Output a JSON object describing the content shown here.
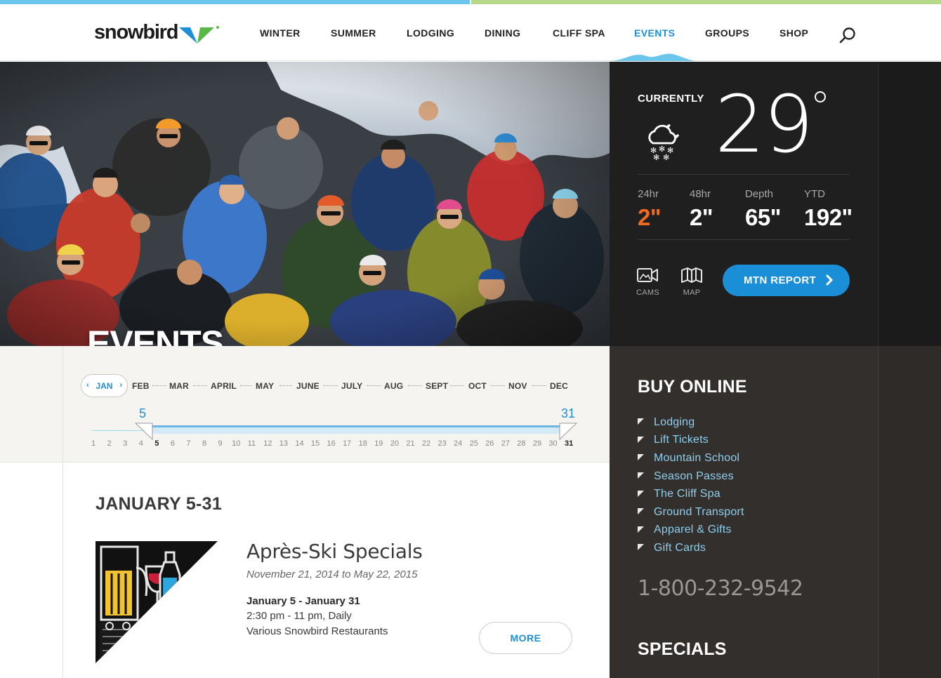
{
  "brand": {
    "logo_text": "snowbird",
    "accent": "#1d8fd6",
    "orange": "#f26a21"
  },
  "nav": {
    "items": [
      "WINTER",
      "SUMMER",
      "LODGING",
      "DINING",
      "CLIFF SPA",
      "EVENTS",
      "GROUPS",
      "SHOP"
    ],
    "active": "EVENTS",
    "search_icon": "search-icon"
  },
  "hero": {
    "title": "EVENTS"
  },
  "weather": {
    "label": "CURRENTLY",
    "icon": "snow-cloud-moon-icon",
    "temperature": "29",
    "stats": [
      {
        "label": "24hr",
        "value": "2\""
      },
      {
        "label": "48hr",
        "value": "2\""
      },
      {
        "label": "Depth",
        "value": "65\""
      },
      {
        "label": "YTD",
        "value": "192\""
      }
    ],
    "tools": [
      {
        "label": "CAMS",
        "icon": "camera-icon"
      },
      {
        "label": "MAP",
        "icon": "map-icon"
      }
    ],
    "report_button": "MTN REPORT"
  },
  "timeline": {
    "months": [
      "JAN",
      "FEB",
      "MAR",
      "APRIL",
      "MAY",
      "JUNE",
      "JULY",
      "AUG",
      "SEPT",
      "OCT",
      "NOV",
      "DEC"
    ],
    "selected_month": "JAN",
    "range_start": "5",
    "range_end": "31",
    "days": [
      "1",
      "2",
      "3",
      "4",
      "5",
      "6",
      "7",
      "8",
      "9",
      "10",
      "11",
      "12",
      "13",
      "14",
      "15",
      "16",
      "17",
      "18",
      "19",
      "20",
      "21",
      "22",
      "23",
      "24",
      "25",
      "26",
      "27",
      "28",
      "29",
      "30",
      "31"
    ]
  },
  "events": {
    "date_heading": "JANUARY 5-31",
    "items": [
      {
        "title": "Après-Ski Specials",
        "range": "November 21, 2014 to May 22, 2015",
        "when": "January 5 - January 31",
        "time": "2:30 pm - 11 pm, Daily",
        "place": "Various Snowbird Restaurants",
        "more": "MORE"
      }
    ]
  },
  "sidebar": {
    "buy_heading": "BUY ONLINE",
    "links": [
      "Lodging",
      "Lift Tickets",
      "Mountain School",
      "Season Passes",
      "The Cliff Spa",
      "Ground Transport",
      "Apparel & Gifts",
      "Gift Cards"
    ],
    "phone": "1-800-232-9542",
    "specials_heading": "SPECIALS"
  }
}
